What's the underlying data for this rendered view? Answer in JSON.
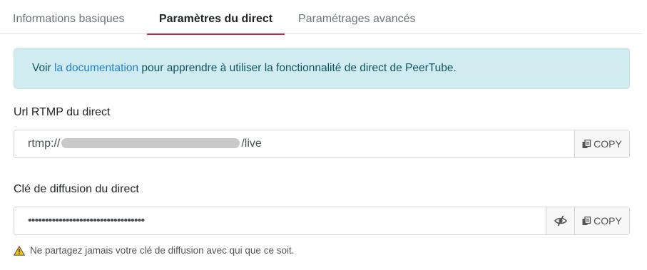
{
  "tabs": [
    {
      "label": "Informations basiques",
      "active": false
    },
    {
      "label": "Paramètres du direct",
      "active": true
    },
    {
      "label": "Paramétrages avancés",
      "active": false
    }
  ],
  "alert": {
    "prefix": "Voir ",
    "link": "la documentation",
    "suffix": " pour apprendre à utiliser la fonctionnalité de direct de PeerTube."
  },
  "rtmp": {
    "label": "Url RTMP du direct",
    "value_prefix": "rtmp://",
    "value_suffix": "/live",
    "copy_label": "COPY",
    "copy_icon": "copy-icon"
  },
  "stream_key": {
    "label": "Clé de diffusion du direct",
    "value_masked": "••••••••••••••••••••••••••••••••••",
    "visibility_icon": "eye-slash-icon",
    "copy_label": "COPY",
    "copy_icon": "copy-icon"
  },
  "warning": {
    "icon": "warning-icon",
    "text": "Ne partagez jamais votre clé de diffusion avec qui que ce soit."
  },
  "colors": {
    "active_tab_underline": "#c9283e",
    "alert_background": "#d1ecf1",
    "link": "#1f7fd0",
    "warning_icon": "#f0c419"
  }
}
